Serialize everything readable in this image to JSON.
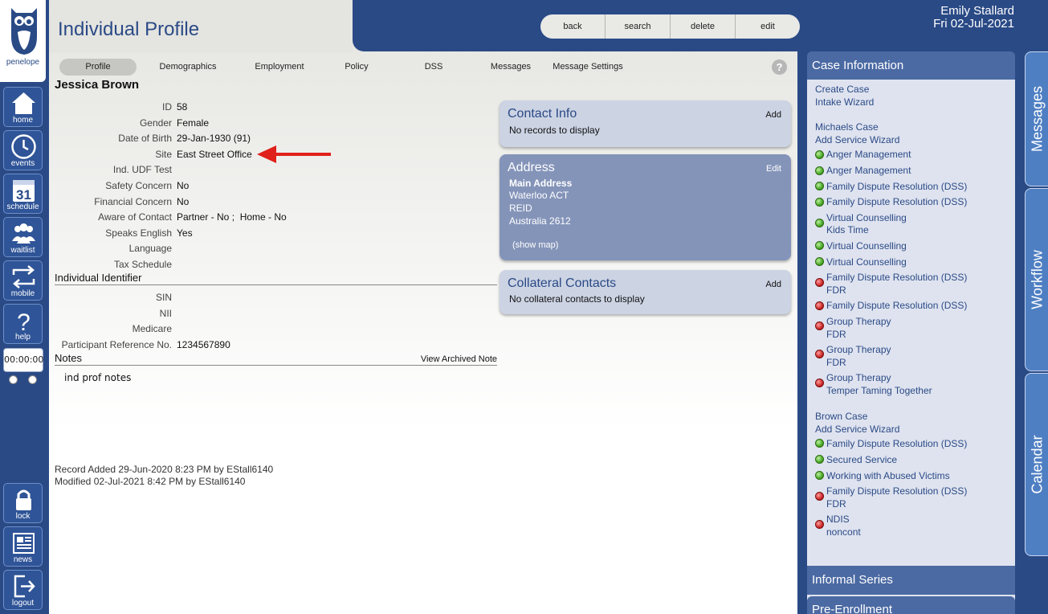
{
  "app": {
    "brand": "penelope",
    "title": "Individual Profile"
  },
  "user": {
    "name": "Emily Stallard",
    "date": "Fri 02-Jul-2021"
  },
  "actions": [
    "back",
    "search",
    "delete",
    "edit"
  ],
  "nav": {
    "items": [
      {
        "label": "home",
        "icon": "home-icon"
      },
      {
        "label": "events",
        "icon": "clock-icon"
      },
      {
        "label": "schedule",
        "icon": "calendar-31-icon",
        "day": "31"
      },
      {
        "label": "waitlist",
        "icon": "people-icon"
      },
      {
        "label": "mobile",
        "icon": "sync-arrows-icon"
      },
      {
        "label": "help",
        "icon": "question-icon",
        "glyph": "?"
      }
    ],
    "bottom": [
      {
        "label": "lock",
        "icon": "lock-icon"
      },
      {
        "label": "news",
        "icon": "newspaper-icon"
      },
      {
        "label": "logout",
        "icon": "logout-icon"
      }
    ],
    "timer": "00:00:00"
  },
  "tabs": [
    "Profile",
    "Demographics",
    "Employment",
    "Policy",
    "DSS",
    "Messages",
    "Message Settings"
  ],
  "active_tab": "Profile",
  "help_glyph": "?",
  "profile": {
    "name": "Jessica Brown",
    "fields": [
      {
        "label": "ID",
        "value": "58"
      },
      {
        "label": "Gender",
        "value": "Female"
      },
      {
        "label": "Date of Birth",
        "value": "29-Jan-1930 (91)"
      },
      {
        "label": "Site",
        "value": "East Street Office"
      },
      {
        "label": "Ind. UDF Test",
        "value": ""
      },
      {
        "label": "Safety Concern",
        "value": "No"
      },
      {
        "label": "Financial Concern",
        "value": "No"
      },
      {
        "label": "Aware of Contact",
        "value": "Partner - No ;  Home - No"
      },
      {
        "label": "Speaks English",
        "value": "Yes"
      },
      {
        "label": "Language",
        "value": ""
      },
      {
        "label": "Tax Schedule",
        "value": ""
      }
    ],
    "identifier_section": "Individual Identifier",
    "identifiers": [
      {
        "label": "SIN",
        "value": ""
      },
      {
        "label": "NII",
        "value": ""
      },
      {
        "label": "Medicare",
        "value": ""
      },
      {
        "label": "Participant Reference No.",
        "value": "1234567890"
      }
    ],
    "notes_section": "Notes",
    "view_archived": "View Archived Note",
    "notes_text": "ind prof notes",
    "record_added": "Record Added 29-Jun-2020 8:23 PM by EStall6140",
    "modified": "Modified 02-Jul-2021 8:42 PM by EStall6140"
  },
  "cards": {
    "contact": {
      "title": "Contact Info",
      "action": "Add",
      "body": "No records to display"
    },
    "address": {
      "title": "Address",
      "action": "Edit",
      "label": "Main Address",
      "lines": [
        "Waterloo ACT",
        "REID",
        "Australia 2612"
      ],
      "map": "(show map)"
    },
    "collateral": {
      "title": "Collateral Contacts",
      "action": "Add",
      "body": "No collateral contacts to display"
    }
  },
  "case_info": {
    "title": "Case Information",
    "top_links": [
      "Create Case",
      "Intake Wizard"
    ],
    "groups": [
      {
        "name": "Michaels Case",
        "wizard": "Add Service Wizard",
        "services": [
          {
            "status": "green",
            "lines": [
              "Anger Management"
            ]
          },
          {
            "status": "green",
            "lines": [
              "Anger Management"
            ]
          },
          {
            "status": "green",
            "lines": [
              "Family Dispute Resolution (DSS)"
            ]
          },
          {
            "status": "green",
            "lines": [
              "Family Dispute Resolution (DSS)"
            ]
          },
          {
            "status": "green",
            "lines": [
              "Virtual Counselling",
              "Kids Time"
            ]
          },
          {
            "status": "green",
            "lines": [
              "Virtual Counselling"
            ]
          },
          {
            "status": "green",
            "lines": [
              "Virtual Counselling"
            ]
          },
          {
            "status": "red",
            "lines": [
              "Family Dispute Resolution (DSS)",
              "FDR"
            ]
          },
          {
            "status": "red",
            "lines": [
              "Family Dispute Resolution (DSS)"
            ]
          },
          {
            "status": "red",
            "lines": [
              "Group Therapy",
              "FDR"
            ]
          },
          {
            "status": "red",
            "lines": [
              "Group Therapy",
              "FDR"
            ]
          },
          {
            "status": "red",
            "lines": [
              "Group Therapy",
              "Temper Taming Together"
            ]
          }
        ]
      },
      {
        "name": "Brown Case",
        "wizard": "Add Service Wizard",
        "services": [
          {
            "status": "green",
            "lines": [
              "Family Dispute Resolution (DSS)"
            ]
          },
          {
            "status": "green",
            "lines": [
              "Secured Service"
            ]
          },
          {
            "status": "green",
            "lines": [
              "Working with Abused Victims"
            ]
          },
          {
            "status": "red",
            "lines": [
              "Family Dispute Resolution (DSS)",
              "FDR"
            ]
          },
          {
            "status": "red",
            "lines": [
              "NDIS",
              "noncont"
            ]
          }
        ]
      }
    ]
  },
  "informal_series": "Informal Series",
  "pre_enrollment": "Pre-Enrollment",
  "side_tabs": [
    "Messages",
    "Workflow",
    "Calendar"
  ],
  "colors": {
    "brand_blue": "#2a4a86",
    "panel_blue": "#4b6aa3",
    "status_green": "#3a9d1a",
    "status_red": "#c31a1a",
    "arrow_red": "#e0201a"
  }
}
